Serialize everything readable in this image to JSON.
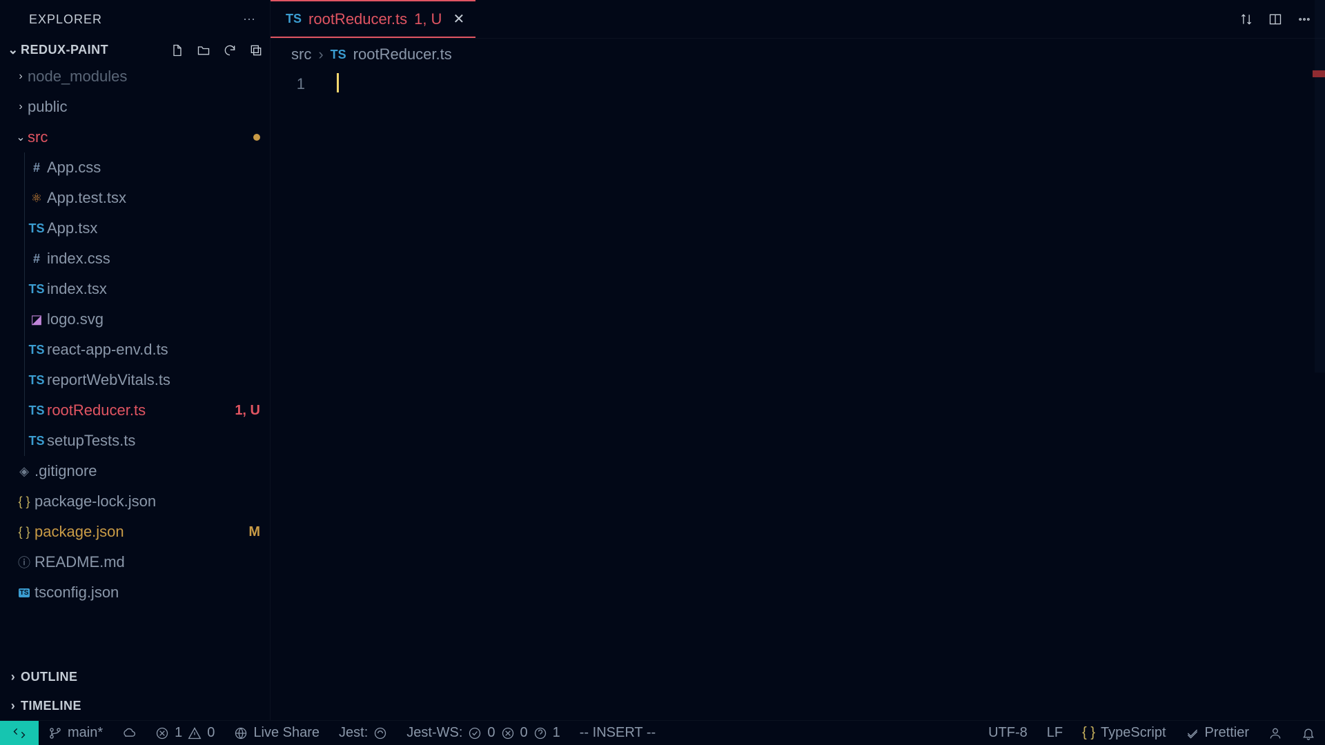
{
  "explorer": {
    "title": "EXPLORER"
  },
  "project": {
    "name": "REDUX-PAINT"
  },
  "tree": {
    "node_modules": "node_modules",
    "public": "public",
    "src": "src",
    "files": {
      "appcss": "App.css",
      "apptest": "App.test.tsx",
      "apptsx": "App.tsx",
      "indexcss": "index.css",
      "indextsx": "index.tsx",
      "logo": "logo.svg",
      "reactenv": "react-app-env.d.ts",
      "reportwv": "reportWebVitals.ts",
      "rootreducer": "rootReducer.ts",
      "rootreducer_badge": "1, U",
      "setuptests": "setupTests.ts"
    },
    "gitignore": ".gitignore",
    "pkglock": "package-lock.json",
    "pkg": "package.json",
    "pkg_badge": "M",
    "readme": "README.md",
    "tsconfig": "tsconfig.json"
  },
  "panels": {
    "outline": "OUTLINE",
    "timeline": "TIMELINE"
  },
  "tab": {
    "name": "rootReducer.ts",
    "suffix": "1, U"
  },
  "breadcrumb": {
    "src": "src",
    "file": "rootReducer.ts"
  },
  "editor": {
    "line1": "1"
  },
  "status": {
    "branch": "main*",
    "err": "1",
    "warn": "0",
    "liveshare": "Live Share",
    "jest": "Jest:",
    "jestws": "Jest-WS:",
    "j0a": "0",
    "j0b": "0",
    "j1": "1",
    "mode": "-- INSERT --",
    "enc": "UTF-8",
    "eol": "LF",
    "lang": "TypeScript",
    "prettier": "Prettier"
  }
}
